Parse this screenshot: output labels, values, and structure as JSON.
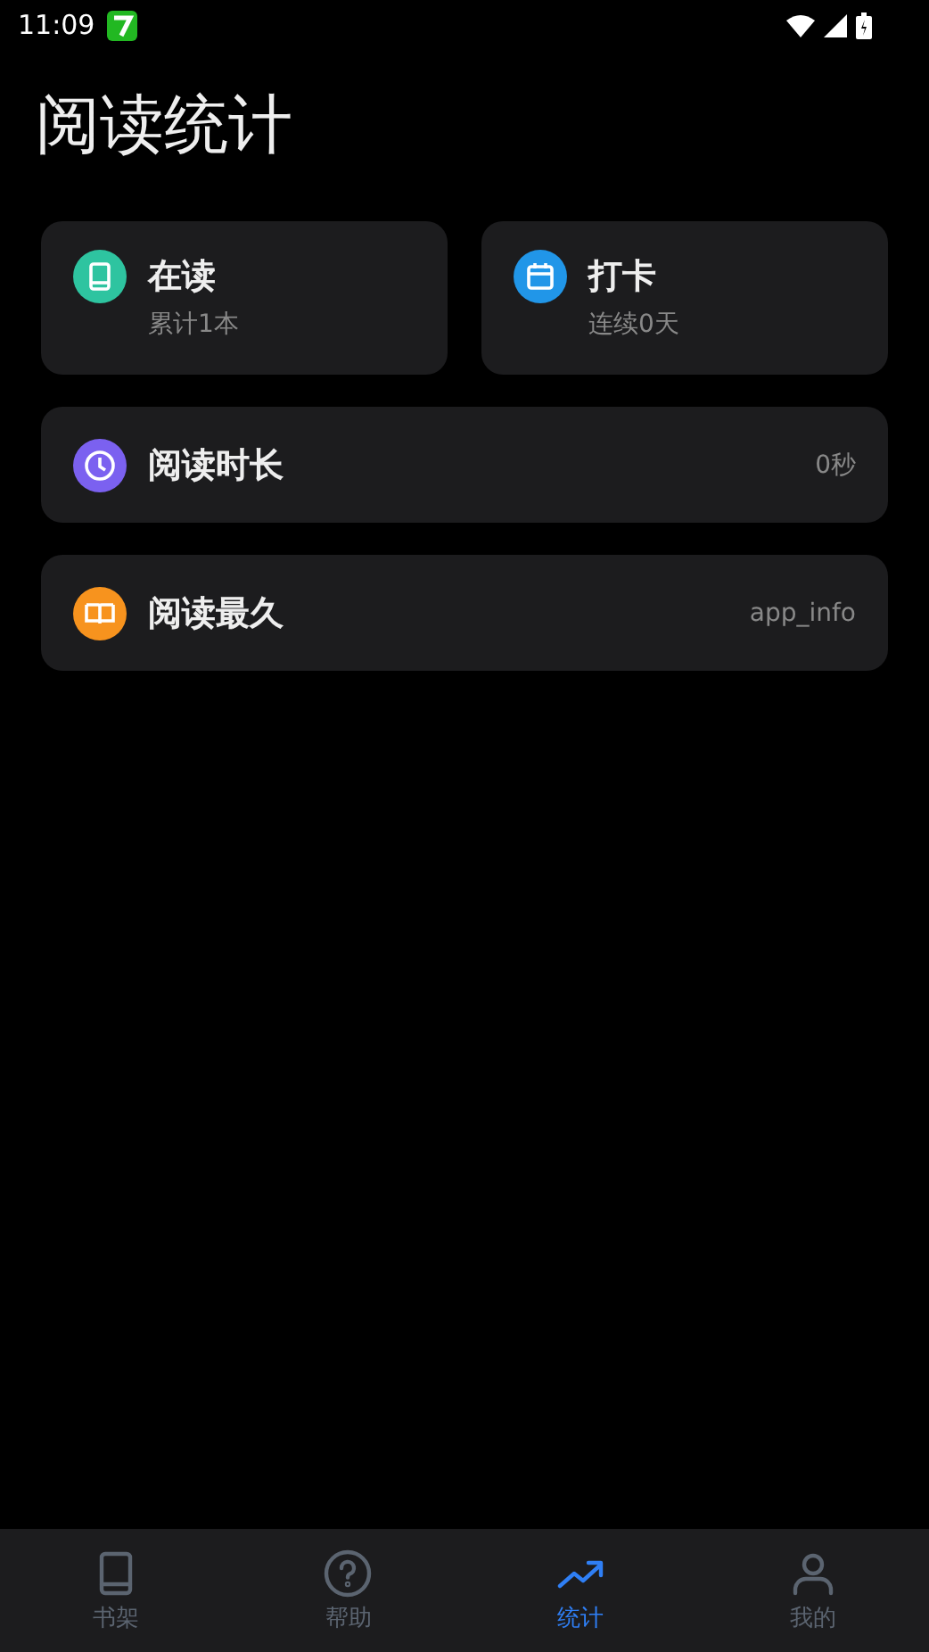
{
  "status_bar": {
    "time": "11:09"
  },
  "title": "阅读统计",
  "summary_cards": [
    {
      "kind": "book",
      "color": "#2ec4a0",
      "title": "在读",
      "subtitle": "累计1本"
    },
    {
      "kind": "calendar",
      "color": "#2196e8",
      "title": "打卡",
      "subtitle": "连续0天"
    }
  ],
  "rows": [
    {
      "kind": "clock",
      "color": "#7b61f0",
      "title": "阅读时长",
      "value": "0秒"
    },
    {
      "kind": "openbook",
      "color": "#f7931e",
      "title": "阅读最久",
      "value": "app_info"
    }
  ],
  "bottom_nav": [
    {
      "kind": "book",
      "label": "书架",
      "selected": false
    },
    {
      "kind": "help",
      "label": "帮助",
      "selected": false
    },
    {
      "kind": "trend",
      "label": "统计",
      "selected": true
    },
    {
      "kind": "person",
      "label": "我的",
      "selected": false
    }
  ]
}
